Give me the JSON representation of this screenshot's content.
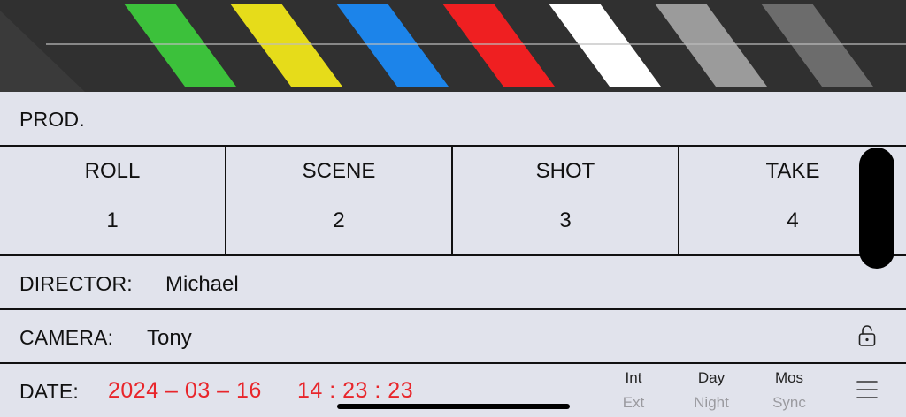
{
  "prod": {
    "label": "PROD."
  },
  "grid": [
    {
      "header": "ROLL",
      "value": "1"
    },
    {
      "header": "SCENE",
      "value": "2"
    },
    {
      "header": "SHOT",
      "value": "3"
    },
    {
      "header": "TAKE",
      "value": "4"
    }
  ],
  "director": {
    "label": "DIRECTOR:",
    "value": "Michael"
  },
  "camera": {
    "label": "CAMERA:",
    "value": "Tony"
  },
  "date": {
    "label": "DATE:",
    "date": "2024 – 03 – 16",
    "time": "14 : 23 : 23"
  },
  "options": [
    {
      "on": "Int",
      "off": "Ext"
    },
    {
      "on": "Day",
      "off": "Night"
    },
    {
      "on": "Mos",
      "off": "Sync"
    }
  ],
  "stripe_colors": [
    "#3cc13b",
    "#e6dc1a",
    "#1c84ea",
    "#ef1f21",
    "#ffffff",
    "#9b9b9b",
    "#6c6c6c"
  ],
  "colors": {
    "date_red": "#e8262b",
    "background": "#e1e3ec",
    "clapper_bg": "#303030"
  },
  "icons": {
    "lock": "lock-open-icon",
    "menu": "hamburger-menu-icon"
  }
}
